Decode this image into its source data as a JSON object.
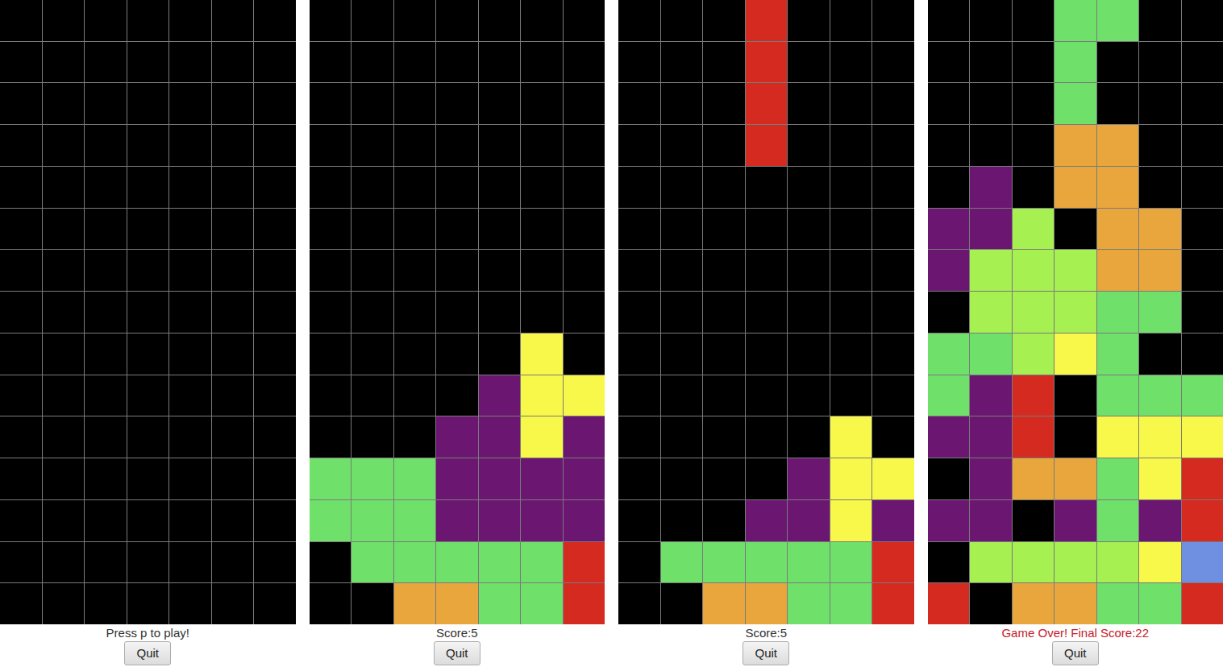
{
  "palette": {
    "G": "#6fe06a",
    "P": "#6b1670",
    "Y": "#f8f84a",
    "R": "#d42a20",
    "O": "#e8a63c",
    "L": "#a6f052",
    "B": "#6f90e0"
  },
  "boards": [
    {
      "status": "Press p to play!",
      "game_over": false,
      "button": "Quit",
      "rows": [
        ".......",
        ".......",
        ".......",
        ".......",
        ".......",
        ".......",
        ".......",
        ".......",
        ".......",
        ".......",
        ".......",
        ".......",
        ".......",
        ".......",
        "......."
      ]
    },
    {
      "status": "Score:5",
      "game_over": false,
      "button": "Quit",
      "rows": [
        ".......",
        ".......",
        ".......",
        ".......",
        ".......",
        ".......",
        ".......",
        ".......",
        ".....Y.",
        "....PYY",
        "...PPYP",
        "GGGPPPP",
        "GGGPPPP",
        ".GGGGGR",
        "..OOGGR"
      ]
    },
    {
      "status": "Score:5",
      "game_over": false,
      "button": "Quit",
      "rows": [
        "...R...",
        "...R...",
        "...R...",
        "...R...",
        ".......",
        ".......",
        ".......",
        ".......",
        ".......",
        ".......",
        ".....Y.",
        "....PYY",
        "...PPYP",
        ".GGGGGR",
        "..OOGGR"
      ]
    },
    {
      "status": "Game Over! Final Score:22",
      "game_over": true,
      "button": "Quit",
      "rows": [
        "...GG..",
        "...G...",
        "...G...",
        "...OO..",
        ".P.OO..",
        "PPL.OO.",
        "PLLLOO.",
        ".LLLGG.",
        "GGLYG..",
        "GPR.GGG",
        "PPR.YYY",
        ".POOGYR",
        "PP.PGPR",
        ".LLLLYB",
        "R.OOGGR"
      ]
    }
  ]
}
